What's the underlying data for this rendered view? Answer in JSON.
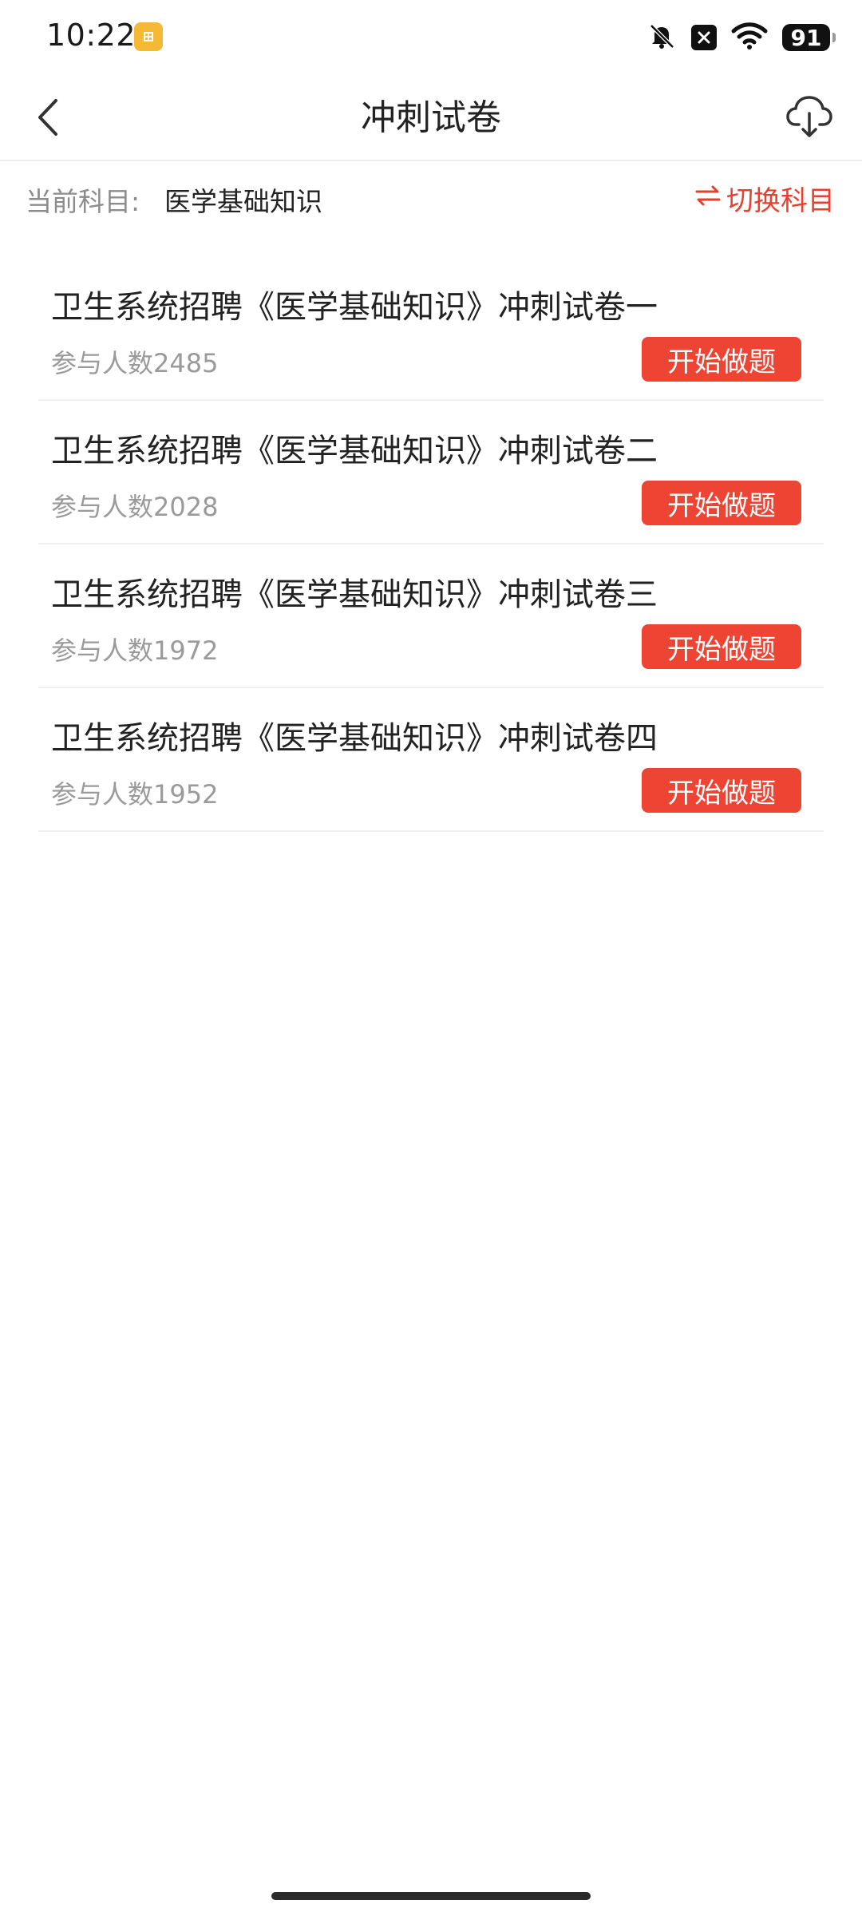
{
  "status_bar": {
    "time": "10:22",
    "battery": "91"
  },
  "header": {
    "title": "冲刺试卷"
  },
  "subject": {
    "label": "当前科目:",
    "value": "医学基础知识",
    "switch_label": "切换科目"
  },
  "papers": [
    {
      "title": "卫生系统招聘《医学基础知识》冲刺试卷一",
      "count": "参与人数2485",
      "button": "开始做题"
    },
    {
      "title": "卫生系统招聘《医学基础知识》冲刺试卷二",
      "count": "参与人数2028",
      "button": "开始做题"
    },
    {
      "title": "卫生系统招聘《医学基础知识》冲刺试卷三",
      "count": "参与人数1972",
      "button": "开始做题"
    },
    {
      "title": "卫生系统招聘《医学基础知识》冲刺试卷四",
      "count": "参与人数1952",
      "button": "开始做题"
    }
  ],
  "icons": {
    "back": "back-arrow-icon",
    "download": "cloud-download-icon",
    "switch": "swap-arrows-icon",
    "mute": "bell-muted-icon",
    "wifi": "wifi-icon"
  },
  "colors": {
    "accent": "#ee4433",
    "switch_text": "#e8402e",
    "app_badge": "#f5b935"
  }
}
